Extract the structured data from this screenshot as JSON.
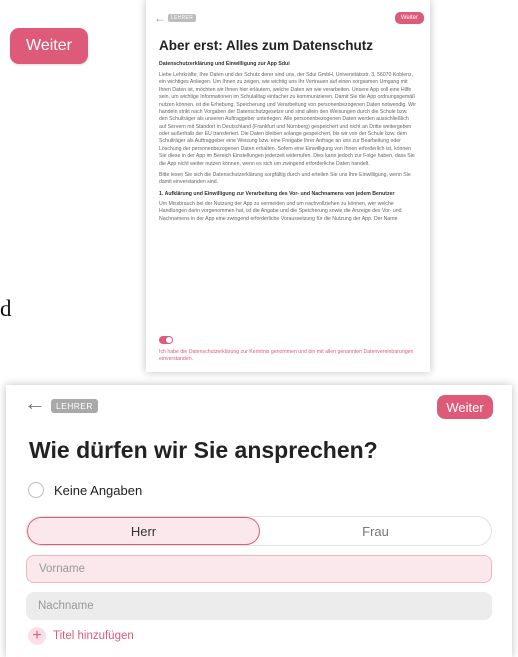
{
  "loose_button": {
    "label": "Weiter"
  },
  "stray_letter": "d",
  "privacy": {
    "role_badge": "LEHRER",
    "next_label": "Weiter",
    "title": "Aber erst: Alles zum Datenschutz",
    "subtitle": "Datenschutzerklärung und Einwilligung zur App Sdui",
    "paragraph_1": "Liebe Lehrkräfte, Ihre Daten und der Schutz derer sind uns, der Sdui GmbH, Universitätsstr. 3, 56070 Koblenz, ein wichtiges Anliegen. Um Ihnen zu zeigen, wie wichtig uns Ihr Vertrauen auf einen sorgsamen Umgang mit Ihren Daten ist, möchten wir Ihnen hier erläutern, welche Daten wir wie verarbeiten. Unsere App soll eine Hilfe sein, um wichtige Informationen im Schulalltag einfacher zu kommunizieren. Damit Sie die App ordnungsgemäß nutzen können, ist die Erhebung, Speicherung und Verarbeitung von personenbezogenen Daten notwendig. Wir handeln strikt nach Vorgaben der Datenschutzgesetze und sind allein den Weisungen durch die Schule bzw. den Schulträger als unseren Auftraggeber unterlegen. Alle personenbezogenen Daten werden ausschließlich auf Servern mit Standort in Deutschland (Frankfurt und Nürnberg) gespeichert und nicht an Dritte weitergeben oder außerhalb der EU transferiert. Die Daten bleiben solange gespeichert, bis wir von der Schule bzw. dem Schulträger als Auftraggeber eine Weisung bzw. eine Freigabe Ihrer Anfrage an uns zur Bearbeitung oder Löschung der personenbezogenen Daten erhalten. Sofern eine Einwilligung von Ihnen erforderlich ist, können Sie diese in der App im Bereich Einstellungen jederzeit widerrufen. Dies kann jedoch zur Folge haben, dass Sie die App nicht weiter nutzen können, wenn es sich um zwingend erforderliche Daten handelt.",
    "paragraph_2": "Bitte lesen Sie sich die Datenschutzerklärung sorgfältig durch und erteilen Sie uns Ihre Einwilligung, wenn Sie damit einverstanden sind.",
    "section_1_heading": "1. Aufklärung und Einwilligung zur Verarbeitung des Vor- und Nachnamens von jedem Benutzer",
    "section_1_text": "Um Missbrauch bei der Nutzung der App zu vermeiden und um nachvollziehen zu können, wer welche Handlungen darin vorgenommen hat, ist die Angabe und die Speicherung sowie die Anzeige des Vor- und Nachnamens in der App eine zwingend erforderliche Voraussetzung für die Nutzung der App. Der Name",
    "consent_on": true,
    "consent_text": "Ich habe die Datenschutzerklärung zur Kenntnis genommen und bin mit allen genannten Datenvereinbarungen einverstanden."
  },
  "form": {
    "role_badge": "LEHRER",
    "next_label": "Weiter",
    "title": "Wie dürfen wir Sie ansprechen?",
    "no_answer_label": "Keine Angaben",
    "salutations": [
      "Herr",
      "Frau"
    ],
    "selected_salutation": "Herr",
    "first_name_placeholder": "Vorname",
    "last_name_placeholder": "Nachname",
    "add_title_label": "Titel hinzufügen"
  }
}
